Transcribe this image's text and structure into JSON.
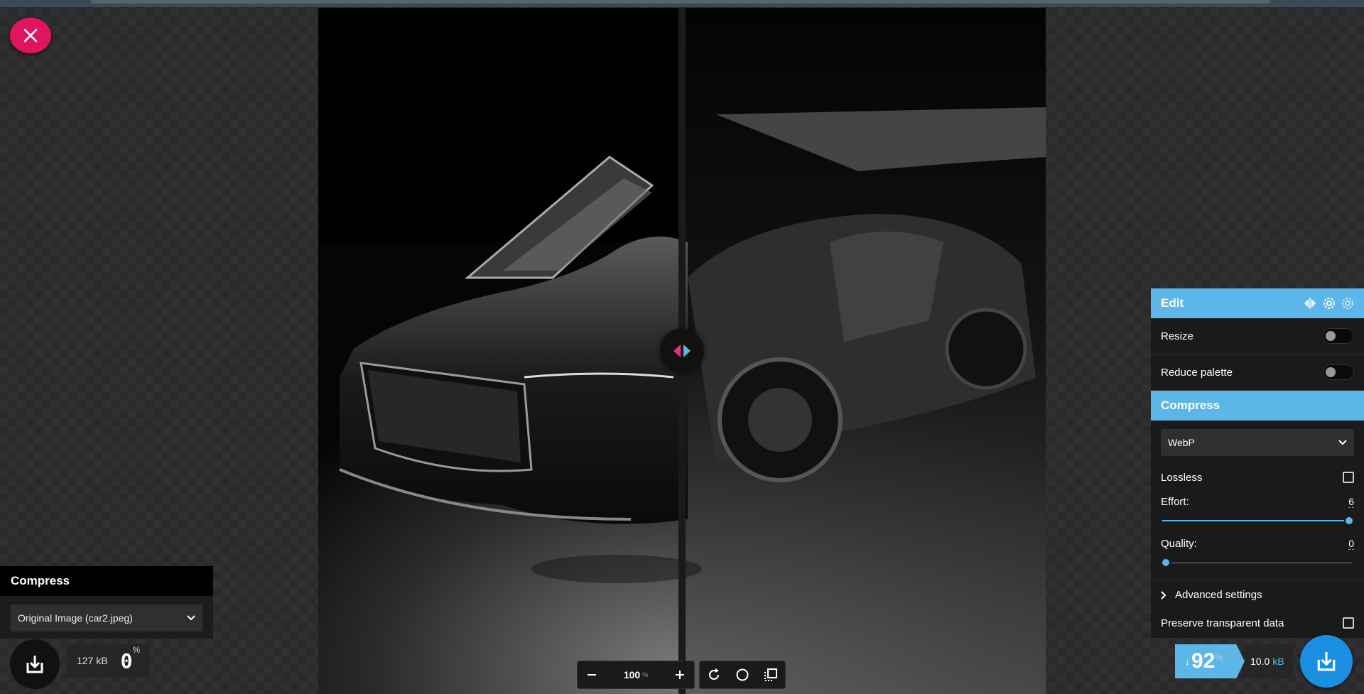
{
  "toolbar": {
    "close_icon": "close-icon"
  },
  "left_panel": {
    "header": "Compress",
    "select_value": "Original Image (car2.jpeg)",
    "size_value": "127",
    "size_unit": "kB",
    "percent": "0",
    "percent_symbol": "%"
  },
  "zoom": {
    "value": "100",
    "unit": "%"
  },
  "right_panel": {
    "edit_header": "Edit",
    "resize_label": "Resize",
    "reduce_palette_label": "Reduce palette",
    "compress_header": "Compress",
    "format_value": "WebP",
    "lossless_label": "Lossless",
    "effort_label": "Effort:",
    "effort_value": "6",
    "effort_fraction": 1.0,
    "quality_label": "Quality:",
    "quality_value": "0",
    "quality_fraction": 0.0,
    "advanced_label": "Advanced settings",
    "preserve_label": "Preserve transparent data",
    "percent_arrow": "↓",
    "percent": "92",
    "percent_symbol": "%",
    "size_value": "10.0",
    "size_unit": "kB"
  },
  "colors": {
    "accent": "#5cb6e8",
    "close": "#e0145f",
    "download": "#1a8ee0",
    "handle_left": "#e8307a",
    "handle_right": "#5cb6e8"
  }
}
